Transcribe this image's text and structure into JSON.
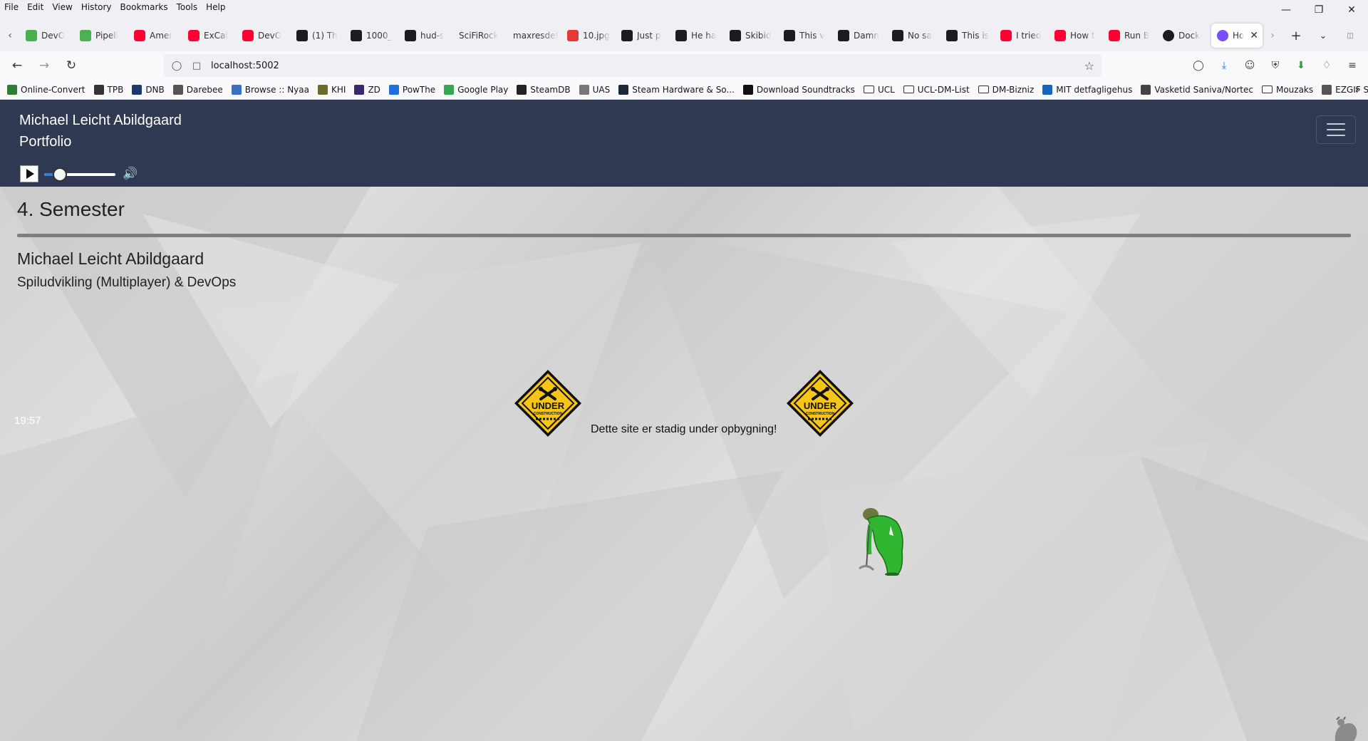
{
  "browser": {
    "menu": [
      "File",
      "Edit",
      "View",
      "History",
      "Bookmarks",
      "Tools",
      "Help"
    ],
    "tabs": [
      {
        "title": "DevO",
        "icon": "pipeline-icon"
      },
      {
        "title": "Pipeli",
        "icon": "pipeline-icon"
      },
      {
        "title": "Amer",
        "icon": "youtube-icon"
      },
      {
        "title": "ExCal",
        "icon": "youtube-icon"
      },
      {
        "title": "DevO",
        "icon": "youtube-icon"
      },
      {
        "title": "(1) Th",
        "icon": "square-icon"
      },
      {
        "title": "1000_",
        "icon": "square-icon"
      },
      {
        "title": "hud-s",
        "icon": "square-icon"
      },
      {
        "title": "SciFiRock",
        "icon": "none"
      },
      {
        "title": "maxresdef",
        "icon": "none"
      },
      {
        "title": "10.jpg",
        "icon": "image-icon"
      },
      {
        "title": "Just p",
        "icon": "square-icon"
      },
      {
        "title": "He ha",
        "icon": "square-icon"
      },
      {
        "title": "Skibid",
        "icon": "square-icon"
      },
      {
        "title": "This v",
        "icon": "square-icon"
      },
      {
        "title": "Damn",
        "icon": "square-icon"
      },
      {
        "title": "No sa",
        "icon": "square-icon"
      },
      {
        "title": "This is",
        "icon": "square-icon"
      },
      {
        "title": "I tried",
        "icon": "youtube-icon"
      },
      {
        "title": "How t",
        "icon": "youtube-icon"
      },
      {
        "title": "Run B",
        "icon": "youtube-icon"
      },
      {
        "title": "Dock",
        "icon": "circle-icon"
      }
    ],
    "active_tab": {
      "title": "Ho"
    },
    "url": "localhost:5002",
    "bookmarks": [
      {
        "label": "Online-Convert",
        "color": "#2e7d32"
      },
      {
        "label": "TPB",
        "color": "#333333"
      },
      {
        "label": "DNB",
        "color": "#1a3a6b"
      },
      {
        "label": "Darebee",
        "color": "#555555"
      },
      {
        "label": "Browse :: Nyaa",
        "color": "#3a6fc4"
      },
      {
        "label": "KHI",
        "color": "#6b6b2a"
      },
      {
        "label": "ZD",
        "color": "#3b2a6b"
      },
      {
        "label": "PowThe",
        "color": "#1e6fd9"
      },
      {
        "label": "Google Play",
        "color": "#34a853"
      },
      {
        "label": "SteamDB",
        "color": "#222222"
      },
      {
        "label": "UAS",
        "color": "#777777"
      },
      {
        "label": "Steam Hardware & So...",
        "color": "#1b2838"
      },
      {
        "label": "Download Soundtracks",
        "color": "#111111"
      },
      {
        "label": "UCL",
        "color": "folder"
      },
      {
        "label": "UCL-DM-List",
        "color": "folder"
      },
      {
        "label": "DM-Bizniz",
        "color": "folder"
      },
      {
        "label": "MIT detfagligehus",
        "color": "#1565c0"
      },
      {
        "label": "Vasketid Saniva/Nortec",
        "color": "#444444"
      },
      {
        "label": "Mouzaks",
        "color": "folder"
      },
      {
        "label": "EZGIF SpeedChanger",
        "color": "#555555"
      }
    ]
  },
  "site": {
    "brand_line1": "Michael Leicht Abildgaard",
    "brand_line2": "Portfolio",
    "header_bg": "#2f3a52",
    "audio": {
      "volume": 0.2
    },
    "semester_title": "4. Semester",
    "author": "Michael Leicht Abildgaard",
    "subject": "Spiludvikling (Multiplayer) & DevOps",
    "clock": "19:57",
    "construction_message": "Dette site er stadig under opbygning!",
    "sign_text_1": "UNDER",
    "sign_text_2": "CONSTRUCTION"
  }
}
